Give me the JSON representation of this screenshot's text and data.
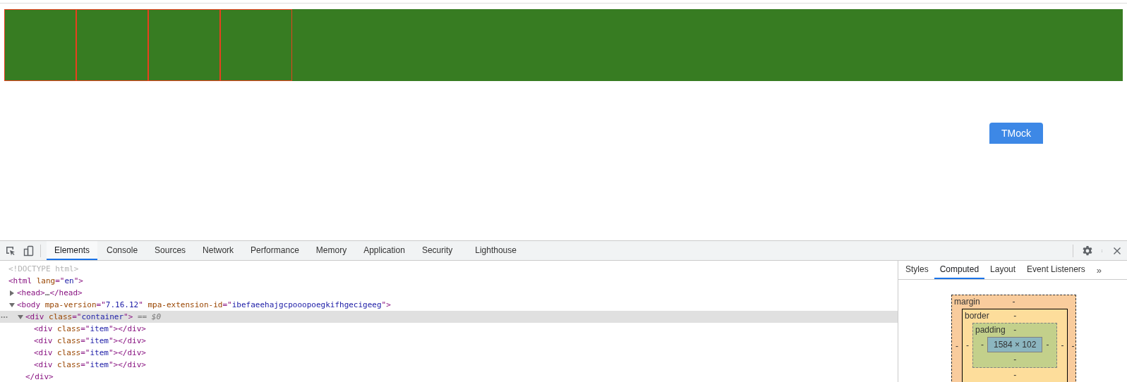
{
  "page": {
    "items": [
      {
        "kind": "item"
      },
      {
        "kind": "item"
      },
      {
        "kind": "item"
      },
      {
        "kind": "item"
      }
    ]
  },
  "tmock_button": {
    "label": "TMock"
  },
  "devtools": {
    "tabs": [
      {
        "label": "Elements",
        "selected": true
      },
      {
        "label": "Console",
        "selected": false
      },
      {
        "label": "Sources",
        "selected": false
      },
      {
        "label": "Network",
        "selected": false
      },
      {
        "label": "Performance",
        "selected": false
      },
      {
        "label": "Memory",
        "selected": false
      },
      {
        "label": "Application",
        "selected": false
      },
      {
        "label": "Security",
        "selected": false
      },
      {
        "label": "Lighthouse",
        "selected": false
      }
    ],
    "dom_tree": [
      {
        "parts": [
          {
            "text": "<!DOCTYPE html>",
            "kind": "doctype"
          }
        ],
        "selected": false
      },
      {
        "parts": [
          {
            "text": "<html",
            "kind": "tag"
          },
          {
            "text": " lang",
            "kind": "attr"
          },
          {
            "text": "=\"",
            "kind": "tag"
          },
          {
            "text": "en",
            "kind": "value"
          },
          {
            "text": "\">",
            "kind": "tag"
          }
        ],
        "selected": false,
        "children": [
          {
            "parts": [
              {
                "text": "<head>",
                "kind": "tag"
              },
              {
                "text": "…",
                "kind": "plain"
              },
              {
                "text": "</head>",
                "kind": "tag"
              }
            ],
            "expanded": false,
            "selected": false
          },
          {
            "parts": [
              {
                "text": "<body",
                "kind": "tag"
              },
              {
                "text": " mpa-version",
                "kind": "attr"
              },
              {
                "text": "=\"",
                "kind": "tag"
              },
              {
                "text": "7.16.12",
                "kind": "value"
              },
              {
                "text": "\"",
                "kind": "tag"
              },
              {
                "text": " mpa-extension-id",
                "kind": "attr"
              },
              {
                "text": "=\"",
                "kind": "tag"
              },
              {
                "text": "ibefaeehajgcpooopoegkifhgecigeeg",
                "kind": "value"
              },
              {
                "text": "\">",
                "kind": "tag"
              }
            ],
            "expanded": true,
            "selected": false,
            "children": [
              {
                "parts": [
                  {
                    "text": "<div",
                    "kind": "tag"
                  },
                  {
                    "text": " class",
                    "kind": "attr"
                  },
                  {
                    "text": "=\"",
                    "kind": "tag"
                  },
                  {
                    "text": "container",
                    "kind": "value"
                  },
                  {
                    "text": "\">",
                    "kind": "tag"
                  },
                  {
                    "text": " == ",
                    "kind": "hint"
                  },
                  {
                    "text": "$0",
                    "kind": "hint-italic"
                  }
                ],
                "expanded": true,
                "selected": true,
                "children": [
                  {
                    "parts": [
                      {
                        "text": "<div",
                        "kind": "tag"
                      },
                      {
                        "text": " class",
                        "kind": "attr"
                      },
                      {
                        "text": "=\"",
                        "kind": "tag"
                      },
                      {
                        "text": "item",
                        "kind": "value"
                      },
                      {
                        "text": "\"></div>",
                        "kind": "tag"
                      }
                    ],
                    "selected": false
                  },
                  {
                    "parts": [
                      {
                        "text": "<div",
                        "kind": "tag"
                      },
                      {
                        "text": " class",
                        "kind": "attr"
                      },
                      {
                        "text": "=\"",
                        "kind": "tag"
                      },
                      {
                        "text": "item",
                        "kind": "value"
                      },
                      {
                        "text": "\"></div>",
                        "kind": "tag"
                      }
                    ],
                    "selected": false
                  },
                  {
                    "parts": [
                      {
                        "text": "<div",
                        "kind": "tag"
                      },
                      {
                        "text": " class",
                        "kind": "attr"
                      },
                      {
                        "text": "=\"",
                        "kind": "tag"
                      },
                      {
                        "text": "item",
                        "kind": "value"
                      },
                      {
                        "text": "\"></div>",
                        "kind": "tag"
                      }
                    ],
                    "selected": false
                  },
                  {
                    "parts": [
                      {
                        "text": "<div",
                        "kind": "tag"
                      },
                      {
                        "text": " class",
                        "kind": "attr"
                      },
                      {
                        "text": "=\"",
                        "kind": "tag"
                      },
                      {
                        "text": "item",
                        "kind": "value"
                      },
                      {
                        "text": "\"></div>",
                        "kind": "tag"
                      }
                    ],
                    "selected": false
                  }
                ],
                "closing": [
                  {
                    "text": "</div>",
                    "kind": "tag"
                  }
                ]
              }
            ]
          }
        ]
      }
    ],
    "sidebar_tabs": [
      {
        "label": "Styles",
        "selected": false
      },
      {
        "label": "Computed",
        "selected": true
      },
      {
        "label": "Layout",
        "selected": false
      },
      {
        "label": "Event Listeners",
        "selected": false
      }
    ],
    "sidebar_overflow": "»",
    "box_model": {
      "margin": {
        "label": "margin",
        "top": "-",
        "left": "-",
        "right": "-"
      },
      "border": {
        "label": "border",
        "top": "-",
        "left": "-",
        "right": "-",
        "bottom": "-"
      },
      "padding": {
        "label": "padding",
        "top": "-",
        "left": "-",
        "right": "-",
        "bottom": "-"
      },
      "content": "1584 × 102"
    }
  }
}
